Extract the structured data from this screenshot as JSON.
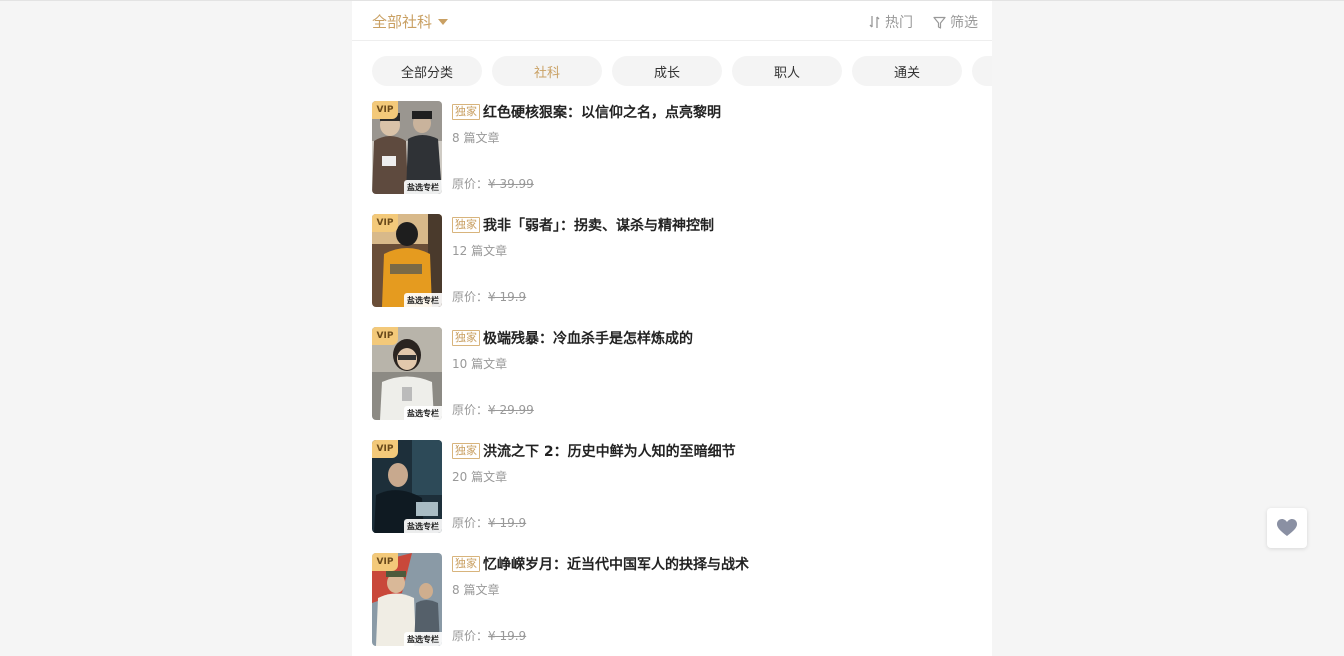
{
  "header": {
    "category_select": "全部社科",
    "sort_label": "热门",
    "filter_label": "筛选"
  },
  "tabs": [
    {
      "label": "全部分类"
    },
    {
      "label": "社科"
    },
    {
      "label": "成长"
    },
    {
      "label": "职人"
    },
    {
      "label": "通关"
    },
    {
      "label": ""
    }
  ],
  "items": [
    {
      "vip": "VIP",
      "cover_tag": "盐选专栏",
      "badge": "独家",
      "title": "红色硬核狠案：以信仰之名，点亮黎明",
      "count": "8 篇文章",
      "price_label": "原价：",
      "price": "¥ 39.99"
    },
    {
      "vip": "VIP",
      "cover_tag": "盐选专栏",
      "badge": "独家",
      "title": "我非「弱者」：拐卖、谋杀与精神控制",
      "count": "12 篇文章",
      "price_label": "原价：",
      "price": "¥ 19.9"
    },
    {
      "vip": "VIP",
      "cover_tag": "盐选专栏",
      "badge": "独家",
      "title": "极端残暴：冷血杀手是怎样炼成的",
      "count": "10 篇文章",
      "price_label": "原价：",
      "price": "¥ 29.99"
    },
    {
      "vip": "VIP",
      "cover_tag": "盐选专栏",
      "badge": "独家",
      "title": "洪流之下 2：历史中鲜为人知的至暗细节",
      "count": "20 篇文章",
      "price_label": "原价：",
      "price": "¥ 19.9"
    },
    {
      "vip": "VIP",
      "cover_tag": "盐选专栏",
      "badge": "独家",
      "title": "忆峥嵘岁月：近当代中国军人的抉择与战术",
      "count": "8 篇文章",
      "price_label": "原价：",
      "price": "¥ 19.9"
    }
  ],
  "icons": {
    "sort": "sort-arrows-icon",
    "filter": "funnel-filter-icon",
    "favorite": "heart-icon",
    "dropdown": "caret-down-icon"
  },
  "colors": {
    "accent": "#c9a063",
    "vip_badge": "#f3c97a",
    "page_bg": "#f5f5f5",
    "tab_bg": "#f4f4f4"
  }
}
